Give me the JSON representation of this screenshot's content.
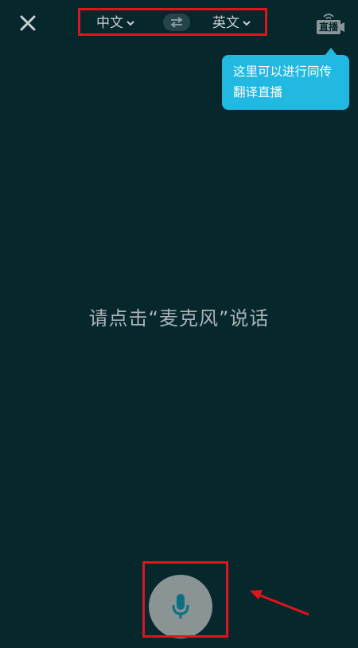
{
  "header": {
    "close_icon": "close-icon",
    "source_language": "中文",
    "target_language": "英文",
    "swap_icon": "swap-arrows-icon",
    "live_label": "直播"
  },
  "tooltip": {
    "line1": "这里可以进行同传",
    "line2": "翻译直播"
  },
  "main": {
    "prompt": "请点击“麦克风”说话"
  },
  "footer": {
    "mic_icon": "microphone-icon"
  },
  "colors": {
    "background": "#06272c",
    "tooltip": "#21b8e1",
    "annotation_red": "#e0141d",
    "mic_button": "#8a9495",
    "mic_icon": "#0e6f80"
  }
}
